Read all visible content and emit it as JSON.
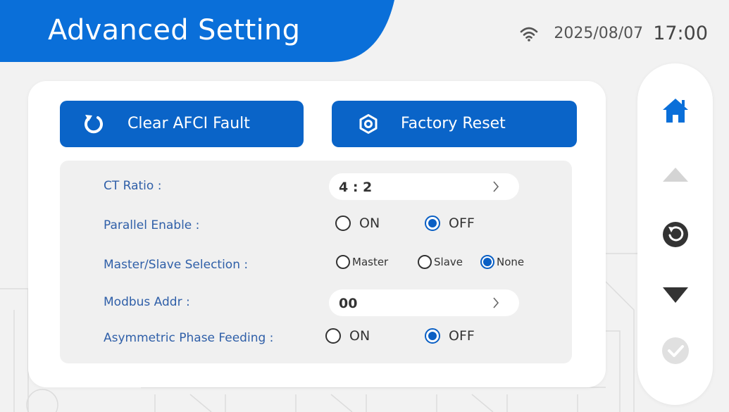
{
  "header": {
    "title": "Advanced Setting",
    "date": "2025/08/07",
    "time": "17:00",
    "accent_color": "#0a6fd9"
  },
  "buttons": {
    "clear_afci": {
      "label": "Clear AFCI Fault",
      "icon": "refresh-icon"
    },
    "factory_reset": {
      "label": "Factory Reset",
      "icon": "hexagon-gear-icon"
    }
  },
  "settings": [
    {
      "label": "CT Ratio :",
      "value": "4 : 2"
    },
    {
      "label": "Parallel Enable :",
      "options": [
        "ON",
        "OFF"
      ],
      "selected": "OFF"
    },
    {
      "label": "Master/Slave Selection :",
      "options": [
        "Master",
        "Slave",
        "None"
      ],
      "selected": "None"
    },
    {
      "label": "Modbus Addr :",
      "value": "00"
    },
    {
      "label": "Asymmetric Phase Feeding :",
      "options": [
        "ON",
        "OFF"
      ],
      "selected": "OFF"
    }
  ],
  "sidebar": {
    "icons": [
      "home-icon",
      "up-arrow-icon",
      "back-icon",
      "down-arrow-icon",
      "confirm-icon"
    ]
  }
}
